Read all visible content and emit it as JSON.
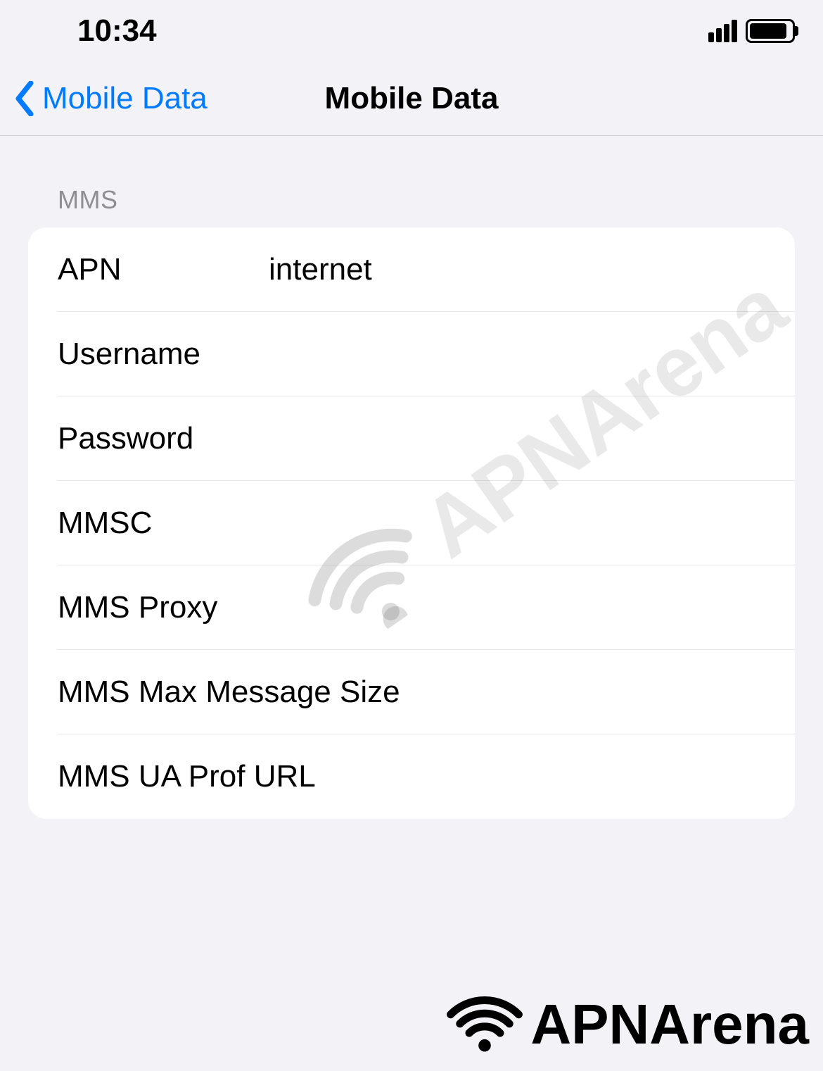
{
  "status": {
    "time": "10:34"
  },
  "nav": {
    "back_label": "Mobile Data",
    "title": "Mobile Data"
  },
  "section": {
    "header": "MMS",
    "rows": [
      {
        "label": "APN",
        "value": "internet"
      },
      {
        "label": "Username",
        "value": ""
      },
      {
        "label": "Password",
        "value": ""
      },
      {
        "label": "MMSC",
        "value": ""
      },
      {
        "label": "MMS Proxy",
        "value": ""
      },
      {
        "label": "MMS Max Message Size",
        "value": ""
      },
      {
        "label": "MMS UA Prof URL",
        "value": ""
      }
    ]
  },
  "watermark": {
    "text": "APNArena"
  },
  "footer": {
    "brand": "APNArena"
  }
}
